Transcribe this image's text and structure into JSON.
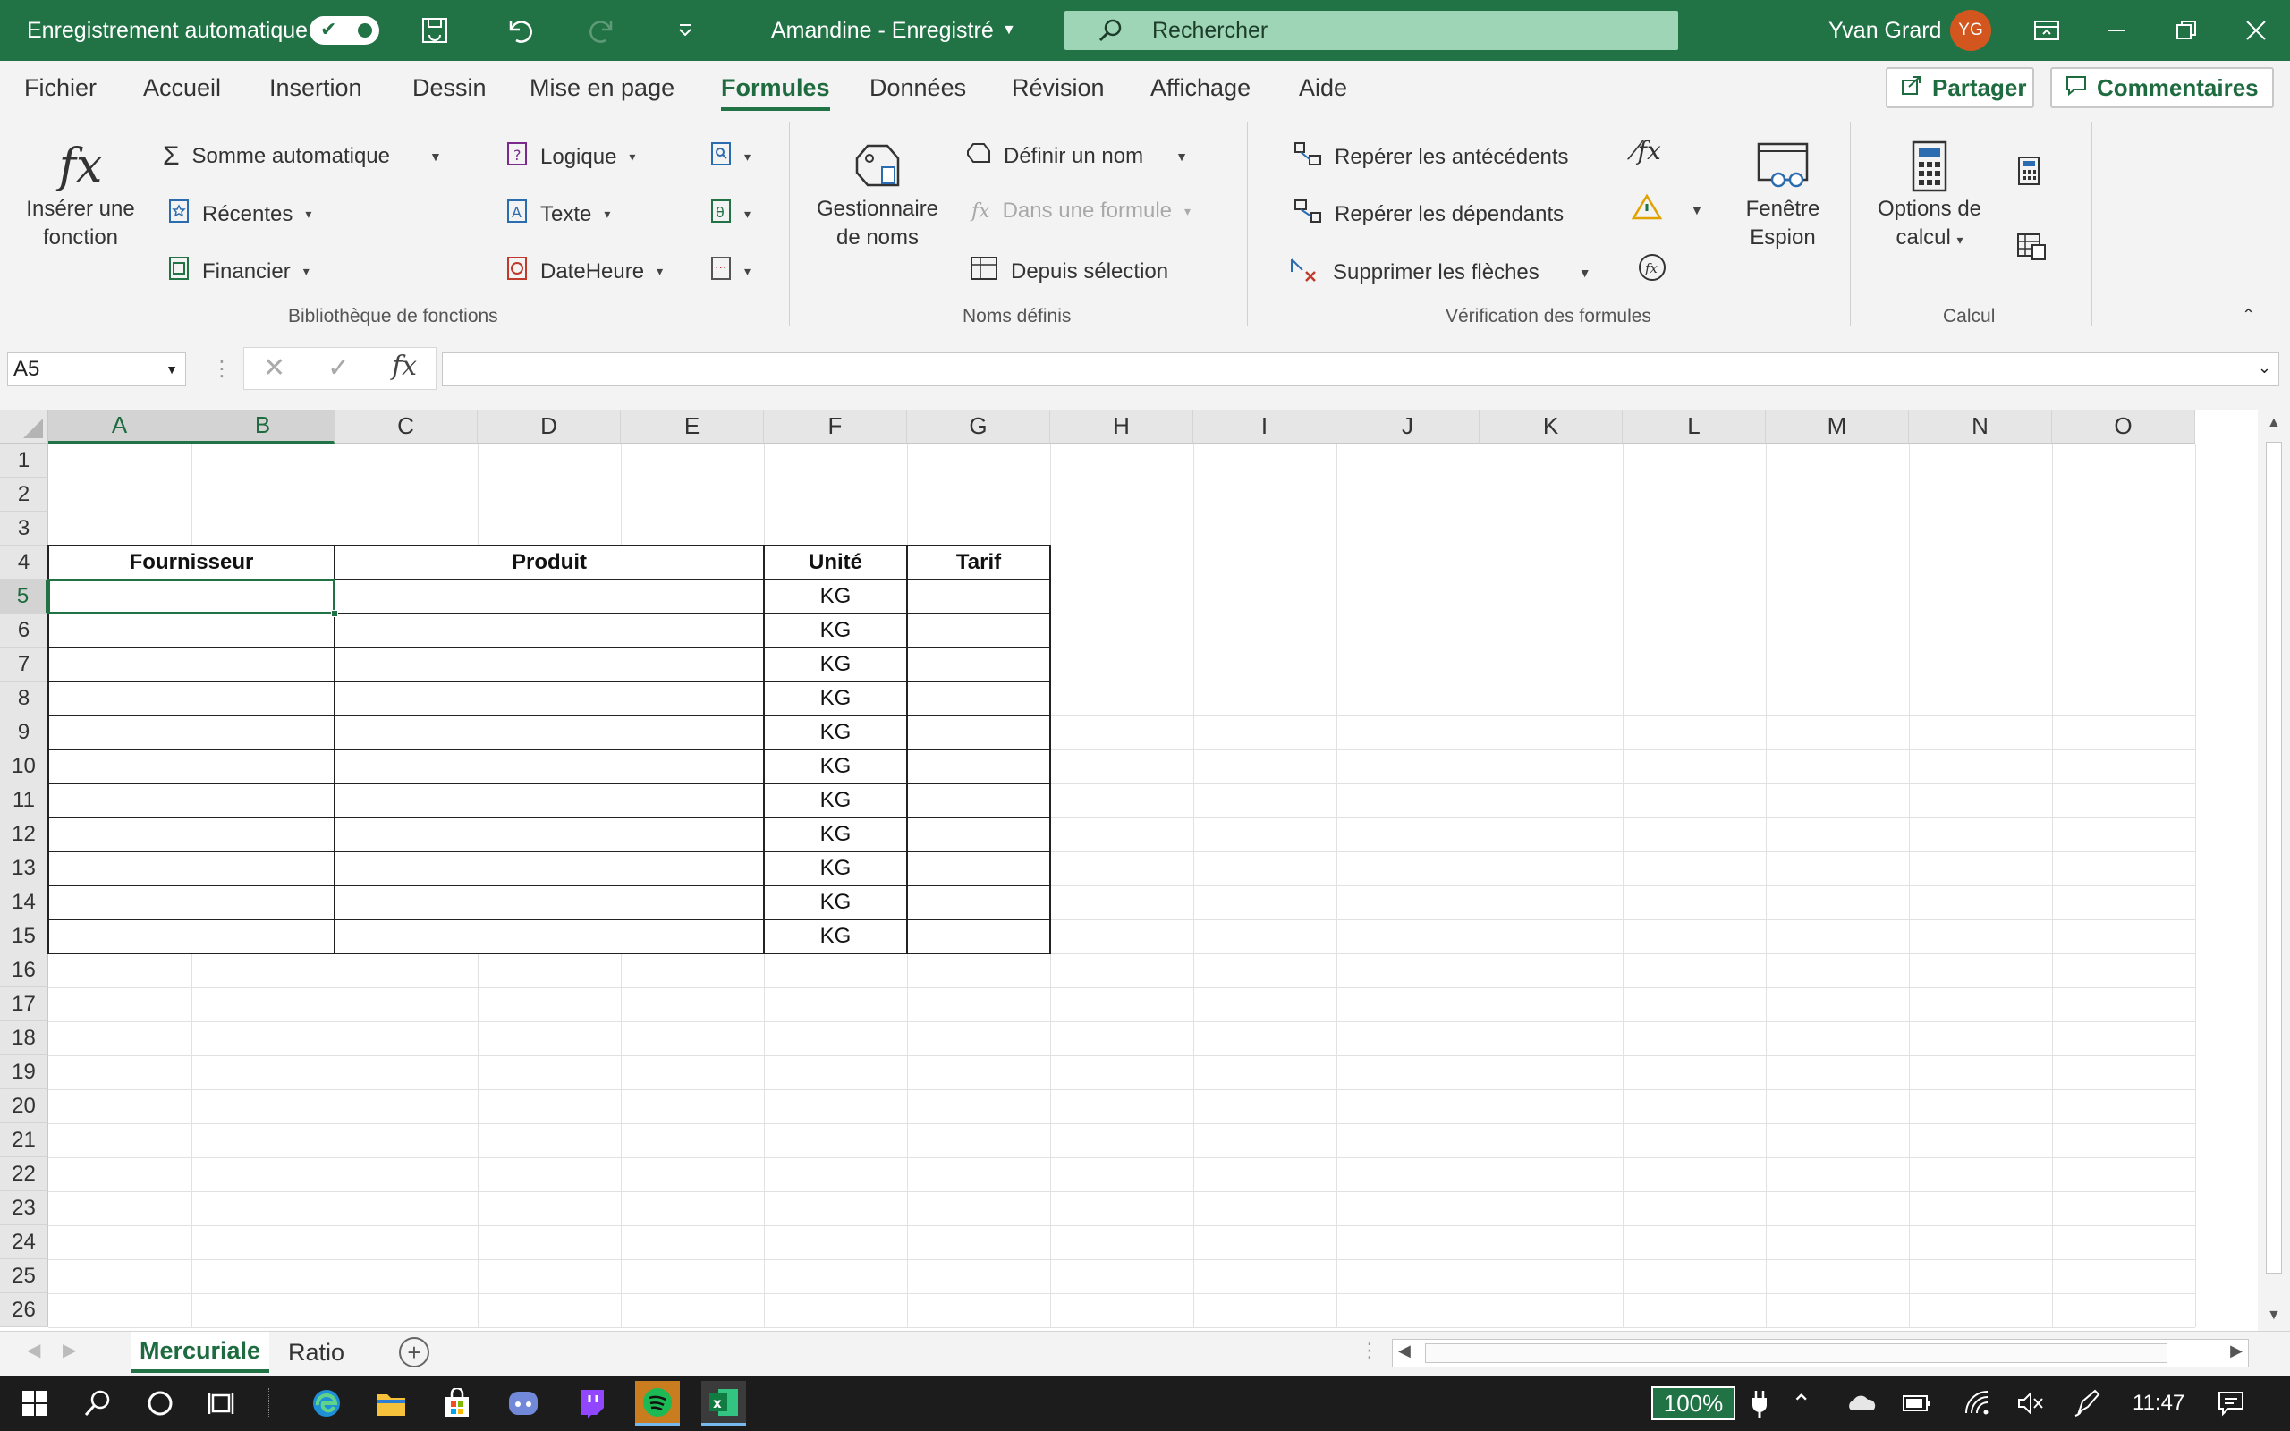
{
  "titlebar": {
    "autosave_label": "Enregistrement automatique",
    "doc_title": "Amandine  -  Enregistré",
    "search_placeholder": "Rechercher",
    "user_name": "Yvan Grard",
    "user_initials": "YG",
    "bg_color": "#217346"
  },
  "menu": {
    "tabs": [
      "Fichier",
      "Accueil",
      "Insertion",
      "Dessin",
      "Mise en page",
      "Formules",
      "Données",
      "Révision",
      "Affichage",
      "Aide"
    ],
    "active_tab": "Formules",
    "share_label": "Partager",
    "comments_label": "Commentaires"
  },
  "ribbon": {
    "insert_function": [
      "Insérer une",
      "fonction"
    ],
    "autosum": "Somme automatique",
    "recent": "Récentes",
    "financial": "Financier",
    "logical": "Logique",
    "text": "Texte",
    "datetime": "DateHeure",
    "group_library": "Bibliothèque de fonctions",
    "name_manager": [
      "Gestionnaire",
      "de noms"
    ],
    "define_name": "Définir un nom",
    "use_in_formula": "Dans une formule",
    "from_selection": "Depuis sélection",
    "group_names": "Noms définis",
    "trace_precedents": "Repérer les antécédents",
    "trace_dependents": "Repérer les dépendants",
    "remove_arrows": "Supprimer les flèches",
    "watch_window": [
      "Fenêtre",
      "Espion"
    ],
    "group_audit": "Vérification des formules",
    "calc_options": [
      "Options de",
      "calcul"
    ],
    "group_calc": "Calcul"
  },
  "formula_bar": {
    "name_box": "A5",
    "fx": "fx",
    "content": ""
  },
  "grid": {
    "columns": [
      "A",
      "B",
      "C",
      "D",
      "E",
      "F",
      "G",
      "H",
      "I",
      "J",
      "K",
      "L",
      "M",
      "N",
      "O"
    ],
    "rows": [
      "1",
      "2",
      "3",
      "4",
      "5",
      "6",
      "7",
      "8",
      "9",
      "10",
      "11",
      "12",
      "13",
      "14",
      "15",
      "16",
      "17",
      "18",
      "19",
      "20",
      "21",
      "22",
      "23",
      "24",
      "25",
      "26"
    ],
    "selected_cell": "A5",
    "table": {
      "headers": {
        "supplier": "Fournisseur",
        "product": "Produit",
        "unit": "Unité",
        "price": "Tarif"
      },
      "unit_values": [
        "KG",
        "KG",
        "KG",
        "KG",
        "KG",
        "KG",
        "KG",
        "KG",
        "KG",
        "KG",
        "KG"
      ]
    }
  },
  "sheets": {
    "tabs": [
      "Mercuriale",
      "Ratio"
    ],
    "active": "Mercuriale"
  },
  "taskbar": {
    "zoom": "100%",
    "time": "11:47"
  }
}
